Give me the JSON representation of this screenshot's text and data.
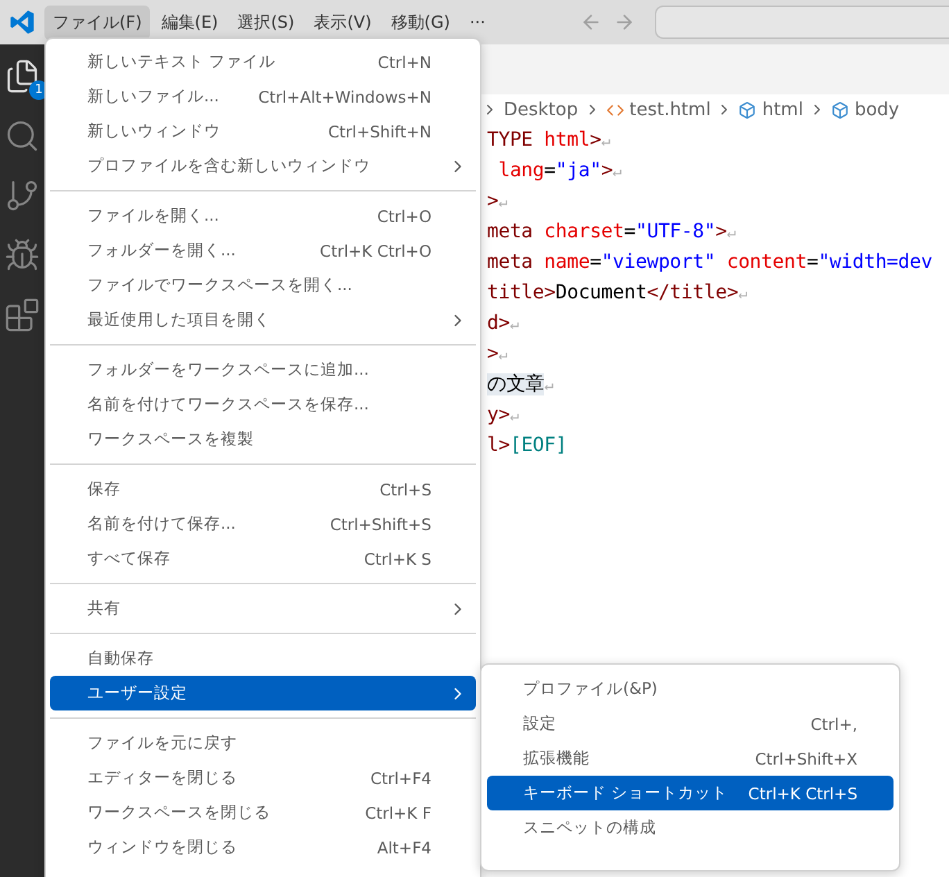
{
  "menubar": {
    "items": [
      {
        "label": "ファイル(F)",
        "selected": true
      },
      {
        "label": "編集(E)",
        "selected": false
      },
      {
        "label": "選択(S)",
        "selected": false
      },
      {
        "label": "表示(V)",
        "selected": false
      },
      {
        "label": "移動(G)",
        "selected": false
      },
      {
        "label": "···",
        "selected": false
      }
    ]
  },
  "activity_bar": {
    "items": [
      {
        "kind": "files",
        "badge": "1"
      },
      {
        "kind": "search"
      },
      {
        "kind": "source-control"
      },
      {
        "kind": "debug"
      },
      {
        "kind": "extensions"
      }
    ]
  },
  "breadcrumbs": [
    {
      "kind": "folder",
      "label": "Desktop"
    },
    {
      "kind": "file",
      "label": "test.html"
    },
    {
      "kind": "element",
      "label": "html"
    },
    {
      "kind": "element",
      "label": "body"
    }
  ],
  "code_lines": [
    [
      {
        "kind": "tag",
        "text": "TYPE"
      },
      {
        "kind": "attr",
        "text": " html"
      },
      {
        "kind": "tag",
        "text": ">"
      },
      {
        "kind": "eol",
        "text": "↵"
      }
    ],
    [
      {
        "kind": "attr",
        "text": " lang"
      },
      {
        "kind": "plain",
        "text": "="
      },
      {
        "kind": "value",
        "text": "\"ja\""
      },
      {
        "kind": "tag",
        "text": ">"
      },
      {
        "kind": "eol",
        "text": "↵"
      }
    ],
    [
      {
        "kind": "tag",
        "text": ">"
      },
      {
        "kind": "eol",
        "text": "↵"
      }
    ],
    [
      {
        "kind": "tag",
        "text": "meta"
      },
      {
        "kind": "attr",
        "text": " charset"
      },
      {
        "kind": "plain",
        "text": "="
      },
      {
        "kind": "value",
        "text": "\"UTF-8\""
      },
      {
        "kind": "tag",
        "text": ">"
      },
      {
        "kind": "eol",
        "text": "↵"
      }
    ],
    [
      {
        "kind": "tag",
        "text": "meta"
      },
      {
        "kind": "attr",
        "text": " name"
      },
      {
        "kind": "plain",
        "text": "="
      },
      {
        "kind": "value",
        "text": "\"viewport\""
      },
      {
        "kind": "attr",
        "text": " content"
      },
      {
        "kind": "plain",
        "text": "="
      },
      {
        "kind": "value",
        "text": "\"width=dev"
      }
    ],
    [
      {
        "kind": "tag",
        "text": "title>"
      },
      {
        "kind": "plain",
        "text": "Document"
      },
      {
        "kind": "tag",
        "text": "</title>"
      },
      {
        "kind": "eol",
        "text": "↵"
      }
    ],
    [
      {
        "kind": "tag",
        "text": "d>"
      },
      {
        "kind": "eol",
        "text": "↵"
      }
    ],
    [
      {
        "kind": "tag",
        "text": ">"
      },
      {
        "kind": "eol",
        "text": "↵"
      }
    ],
    [
      {
        "kind": "highlight",
        "text": "の文章"
      },
      {
        "kind": "eol",
        "text": "↵"
      }
    ],
    [
      {
        "kind": "tag",
        "text": "y>"
      },
      {
        "kind": "eol",
        "text": "↵"
      }
    ],
    [
      {
        "kind": "tag",
        "text": "l>"
      },
      {
        "kind": "eof",
        "text": "[EOF]"
      }
    ]
  ],
  "file_menu": {
    "groups": [
      [
        {
          "label": "新しいテキスト ファイル",
          "shortcut": "Ctrl+N",
          "submenu": false,
          "selected": false
        },
        {
          "label": "新しいファイル...",
          "shortcut": "Ctrl+Alt+Windows+N",
          "submenu": false,
          "selected": false
        },
        {
          "label": "新しいウィンドウ",
          "shortcut": "Ctrl+Shift+N",
          "submenu": false,
          "selected": false
        },
        {
          "label": "プロファイルを含む新しいウィンドウ",
          "submenu": true,
          "selected": false
        }
      ],
      [
        {
          "label": "ファイルを開く...",
          "shortcut": "Ctrl+O",
          "submenu": false,
          "selected": false
        },
        {
          "label": "フォルダーを開く...",
          "shortcut": "Ctrl+K Ctrl+O",
          "submenu": false,
          "selected": false
        },
        {
          "label": "ファイルでワークスペースを開く...",
          "submenu": false,
          "selected": false
        },
        {
          "label": "最近使用した項目を開く",
          "submenu": true,
          "selected": false
        }
      ],
      [
        {
          "label": "フォルダーをワークスペースに追加...",
          "submenu": false,
          "selected": false
        },
        {
          "label": "名前を付けてワークスペースを保存...",
          "submenu": false,
          "selected": false
        },
        {
          "label": "ワークスペースを複製",
          "submenu": false,
          "selected": false
        }
      ],
      [
        {
          "label": "保存",
          "shortcut": "Ctrl+S",
          "submenu": false,
          "selected": false
        },
        {
          "label": "名前を付けて保存...",
          "shortcut": "Ctrl+Shift+S",
          "submenu": false,
          "selected": false
        },
        {
          "label": "すべて保存",
          "shortcut": "Ctrl+K S",
          "submenu": false,
          "selected": false
        }
      ],
      [
        {
          "label": "共有",
          "submenu": true,
          "selected": false
        }
      ],
      [
        {
          "label": "自動保存",
          "submenu": false,
          "selected": false
        },
        {
          "label": "ユーザー設定",
          "submenu": true,
          "selected": true
        }
      ],
      [
        {
          "label": "ファイルを元に戻す",
          "submenu": false,
          "selected": false
        },
        {
          "label": "エディターを閉じる",
          "shortcut": "Ctrl+F4",
          "submenu": false,
          "selected": false
        },
        {
          "label": "ワークスペースを閉じる",
          "shortcut": "Ctrl+K F",
          "submenu": false,
          "selected": false
        },
        {
          "label": "ウィンドウを閉じる",
          "shortcut": "Alt+F4",
          "submenu": false,
          "selected": false
        }
      ]
    ]
  },
  "preferences_submenu": {
    "items": [
      {
        "label": "プロファイル(&P)",
        "selected": false
      },
      {
        "label": "設定",
        "shortcut": "Ctrl+,",
        "selected": false
      },
      {
        "label": "拡張機能",
        "shortcut": "Ctrl+Shift+X",
        "selected": false
      },
      {
        "label": "キーボード ショートカット",
        "shortcut": "Ctrl+K Ctrl+S",
        "selected": true
      },
      {
        "label": "スニペットの構成",
        "selected": false
      }
    ]
  }
}
